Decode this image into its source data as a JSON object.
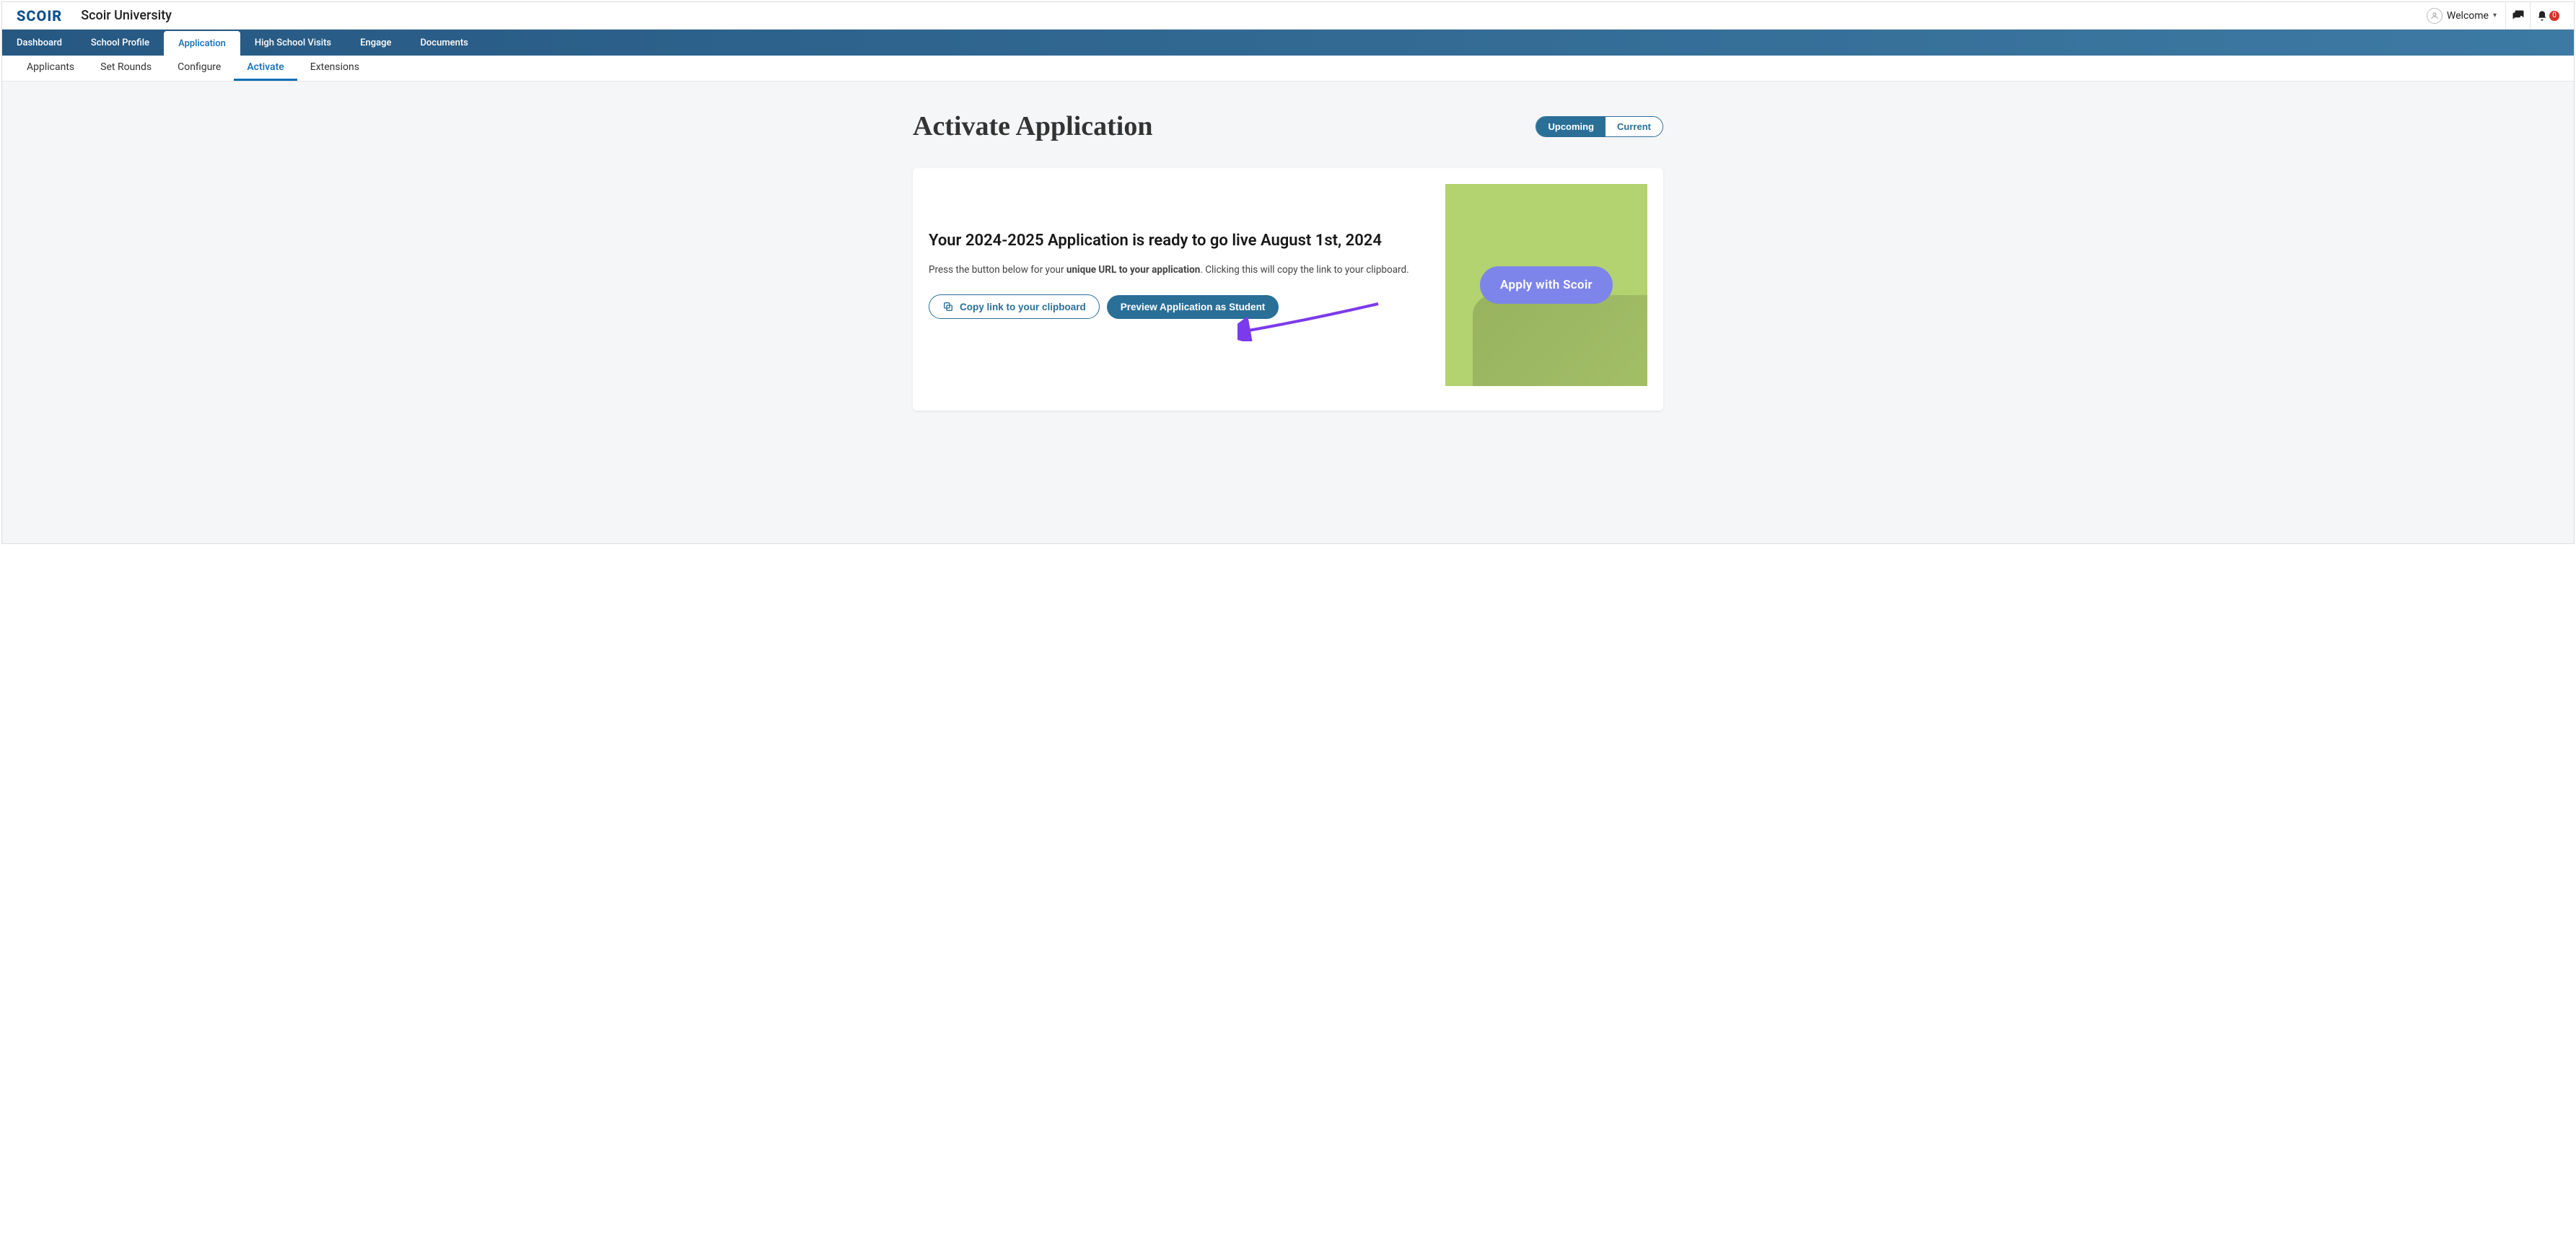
{
  "header": {
    "logo_text": "SCOIR",
    "product_name": "Scoir University",
    "welcome_label": "Welcome",
    "notification_count": "0"
  },
  "primary_nav": {
    "items": [
      {
        "label": "Dashboard",
        "active": false
      },
      {
        "label": "School Profile",
        "active": false
      },
      {
        "label": "Application",
        "active": true
      },
      {
        "label": "High School Visits",
        "active": false
      },
      {
        "label": "Engage",
        "active": false
      },
      {
        "label": "Documents",
        "active": false
      }
    ]
  },
  "secondary_nav": {
    "items": [
      {
        "label": "Applicants",
        "active": false
      },
      {
        "label": "Set Rounds",
        "active": false
      },
      {
        "label": "Configure",
        "active": false
      },
      {
        "label": "Activate",
        "active": true
      },
      {
        "label": "Extensions",
        "active": false
      }
    ]
  },
  "main": {
    "title": "Activate Application",
    "segmented": {
      "upcoming_label": "Upcoming",
      "current_label": "Current"
    },
    "card": {
      "heading": "Your 2024-2025 Application is ready to go live August 1st, 2024",
      "desc_pre": "Press the button below for your ",
      "desc_bold": "unique URL to your application",
      "desc_post": ". Clicking this will copy the link to your clipboard.",
      "copy_btn_label": "Copy link to your clipboard",
      "preview_btn_label": "Preview Application as Student",
      "apply_pill_label": "Apply with Scoir"
    }
  }
}
